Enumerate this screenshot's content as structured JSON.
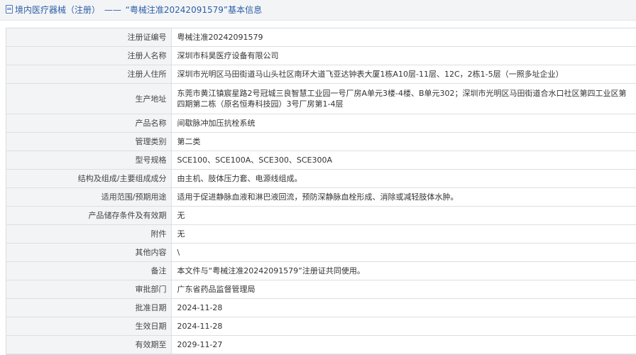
{
  "header": {
    "section": "境内医疗器械（注册）",
    "separator": "——",
    "title": "“粤械注准20242091579”基本信息"
  },
  "rows": [
    {
      "label": "注册证编号",
      "value": "粤械注准20242091579"
    },
    {
      "label": "注册人名称",
      "value": "深圳市科昊医疗设备有限公司"
    },
    {
      "label": "注册人住所",
      "value": "深圳市光明区马田街道马山头社区南环大道飞亚达钟表大厦1栋A10层-11层、12C，2栋1-5层（一照多址企业）"
    },
    {
      "label": "生产地址",
      "value": "东莞市黄江镇宸星路2号冠城三良智慧工业园一号厂房A单元3楼-4楼、B单元302；深圳市光明区马田街道合水口社区第四工业区第四期第二栋（原名恒寿科技园）3号厂房第1-4层"
    },
    {
      "label": "产品名称",
      "value": "间歇脉冲加压抗栓系统"
    },
    {
      "label": "管理类别",
      "value": "第二类"
    },
    {
      "label": "型号规格",
      "value": "SCE100、SCE100A、SCE300、SCE300A"
    },
    {
      "label": "结构及组成/主要组成成分",
      "value": "由主机、肢体压力套、电源线组成。"
    },
    {
      "label": "适用范围/预期用途",
      "value": "适用于促进静脉血液和淋巴液回流，预防深静脉血栓形成、消除或减轻肢体水肿。"
    },
    {
      "label": "产品储存条件及有效期",
      "value": "无"
    },
    {
      "label": "附件",
      "value": "无"
    },
    {
      "label": "其他内容",
      "value": "\\"
    },
    {
      "label": "备注",
      "value": "本文件与“粤械注准20242091579”注册证共同使用。"
    },
    {
      "label": "审批部门",
      "value": "广东省药品监督管理局"
    },
    {
      "label": "批准日期",
      "value": "2024-11-28"
    },
    {
      "label": "生效日期",
      "value": "2024-11-28"
    },
    {
      "label": "有效期至",
      "value": "2029-11-27"
    }
  ]
}
